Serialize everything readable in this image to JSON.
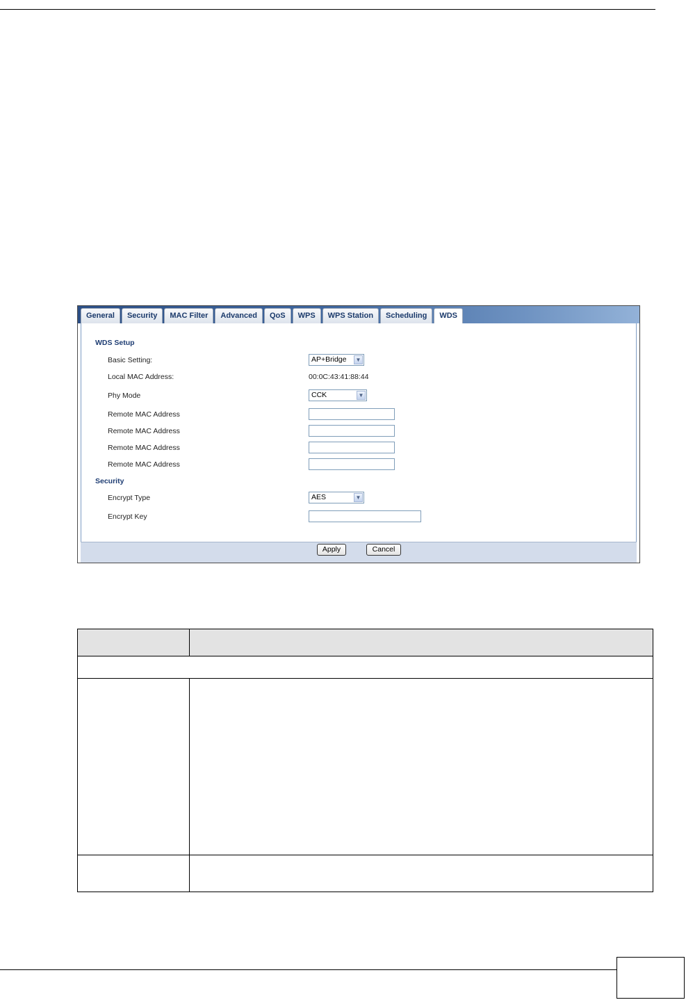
{
  "tabs": [
    "General",
    "Security",
    "MAC Filter",
    "Advanced",
    "QoS",
    "WPS",
    "WPS Station",
    "Scheduling",
    "WDS"
  ],
  "active_tab": "WDS",
  "wds_setup": {
    "title": "WDS Setup",
    "basic_setting_label": "Basic Setting:",
    "basic_setting_value": "AP+Bridge",
    "local_mac_label": "Local MAC Address:",
    "local_mac_value": "00:0C:43:41:88:44",
    "phy_mode_label": "Phy Mode",
    "phy_mode_value": "CCK",
    "remote_mac_labels": [
      "Remote MAC Address",
      "Remote MAC Address",
      "Remote MAC Address",
      "Remote MAC Address"
    ]
  },
  "security": {
    "title": "Security",
    "encrypt_type_label": "Encrypt Type",
    "encrypt_type_value": "AES",
    "encrypt_key_label": "Encrypt Key"
  },
  "buttons": {
    "apply": "Apply",
    "cancel": "Cancel"
  },
  "icons": {
    "dropdown": "chevron-down-icon"
  },
  "colors": {
    "tab_bar": "#2c4f86",
    "section_title": "#1e3d73",
    "footer_bar": "#d3dceb"
  }
}
